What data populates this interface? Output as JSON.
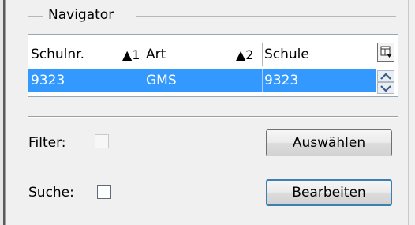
{
  "navigator": {
    "title": "Navigator",
    "grid": {
      "columns": [
        {
          "label": "Schulnr.",
          "sort": "▲1"
        },
        {
          "label": "Art",
          "sort": "▲2"
        },
        {
          "label": "Schule",
          "sort": ""
        }
      ],
      "rows": [
        {
          "schulnr": "9323",
          "art": "GMS",
          "schule": "9323",
          "selected": true
        }
      ]
    }
  },
  "filter": {
    "label": "Filter:",
    "checked": false,
    "enabled": false
  },
  "suche": {
    "label": "Suche:",
    "checked": false,
    "enabled": true
  },
  "buttons": {
    "select": "Auswählen",
    "edit": "Bearbeiten"
  },
  "colors": {
    "selection": "#3399ff",
    "focus_border": "#3c7fb1",
    "background": "#f0f0f0"
  }
}
